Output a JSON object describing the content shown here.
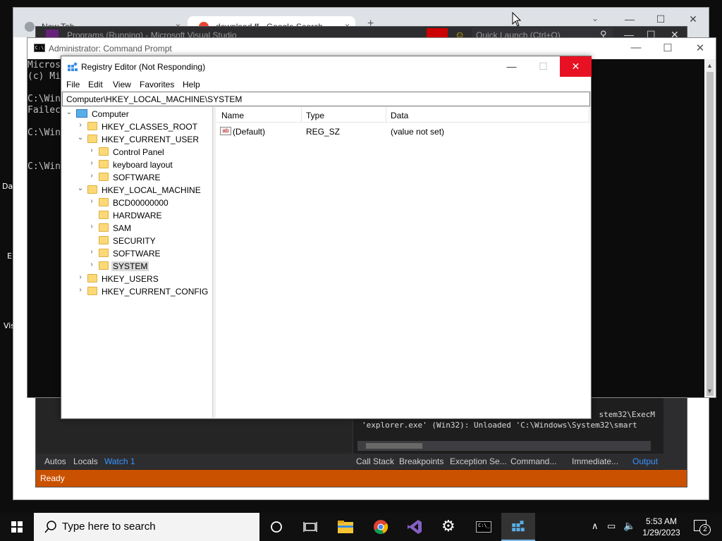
{
  "desktop": {
    "fragments": [
      "Da",
      "E",
      "Vis"
    ]
  },
  "chrome": {
    "tabs": [
      {
        "title": "New Tab",
        "close": "×"
      },
      {
        "title": "download ff - Google Search",
        "close": "×"
      }
    ],
    "new_tab": "+",
    "window_controls": {
      "minimize": "—",
      "maximize": "☐",
      "close": "✕"
    }
  },
  "visual_studio": {
    "title": "Programs (Running) - Microsoft Visual Studio",
    "quick_launch_placeholder": "Quick Launch (Ctrl+Q)",
    "output_lines": [
      "stem32\\ExecM",
      "'explorer.exe' (Win32): Unloaded 'C:\\Windows\\System32\\smart"
    ],
    "left_tabs": [
      "Autos",
      "Locals",
      "Watch 1"
    ],
    "right_tabs": [
      "Call Stack",
      "Breakpoints",
      "Exception Se...",
      "Command...",
      "Immediate...",
      "Output"
    ],
    "status": "Ready",
    "window_controls": {
      "minimize": "—",
      "maximize": "☐",
      "close": "✕"
    }
  },
  "command_prompt": {
    "title": "Administrator: Command Prompt",
    "lines": [
      "Micros",
      "(c) Mi",
      "",
      "C:\\Win",
      "Failec",
      "",
      "C:\\Win",
      "",
      "",
      "C:\\Win"
    ],
    "window_controls": {
      "minimize": "—",
      "maximize": "☐",
      "close": "✕"
    }
  },
  "registry_editor": {
    "title": "Registry Editor (Not Responding)",
    "window_controls": {
      "minimize": "—",
      "maximize": "☐",
      "close": "✕"
    },
    "menu": [
      "File",
      "Edit",
      "View",
      "Favorites",
      "Help"
    ],
    "address": "Computer\\HKEY_LOCAL_MACHINE\\SYSTEM",
    "tree": [
      {
        "label": "Computer",
        "level": 0,
        "expander": "expanded",
        "icon": "computer-icon"
      },
      {
        "label": "HKEY_CLASSES_ROOT",
        "level": 1,
        "expander": "collapsed"
      },
      {
        "label": "HKEY_CURRENT_USER",
        "level": 1,
        "expander": "expanded"
      },
      {
        "label": "Control Panel",
        "level": 2,
        "expander": "collapsed"
      },
      {
        "label": "keyboard layout",
        "level": 2,
        "expander": "collapsed"
      },
      {
        "label": "SOFTWARE",
        "level": 2,
        "expander": "collapsed"
      },
      {
        "label": "HKEY_LOCAL_MACHINE",
        "level": 1,
        "expander": "expanded"
      },
      {
        "label": "BCD00000000",
        "level": 2,
        "expander": "collapsed"
      },
      {
        "label": "HARDWARE",
        "level": 2,
        "expander": "none"
      },
      {
        "label": "SAM",
        "level": 2,
        "expander": "collapsed"
      },
      {
        "label": "SECURITY",
        "level": 2,
        "expander": "none"
      },
      {
        "label": "SOFTWARE",
        "level": 2,
        "expander": "collapsed"
      },
      {
        "label": "SYSTEM",
        "level": 2,
        "expander": "collapsed",
        "selected": true
      },
      {
        "label": "HKEY_USERS",
        "level": 1,
        "expander": "collapsed"
      },
      {
        "label": "HKEY_CURRENT_CONFIG",
        "level": 1,
        "expander": "collapsed"
      }
    ],
    "columns": [
      "Name",
      "Type",
      "Data"
    ],
    "values": [
      {
        "name": "(Default)",
        "type": "REG_SZ",
        "data": "(value not set)",
        "icon": "ab"
      }
    ]
  },
  "taskbar": {
    "search_placeholder": "Type here to search",
    "time": "5:53 AM",
    "date": "1/29/2023",
    "notification_count": "2",
    "pinned": [
      "cortana-icon",
      "task-view-icon",
      "file-explorer-icon",
      "chrome-icon",
      "visual-studio-icon",
      "settings-icon",
      "command-prompt-icon",
      "registry-editor-icon"
    ]
  }
}
